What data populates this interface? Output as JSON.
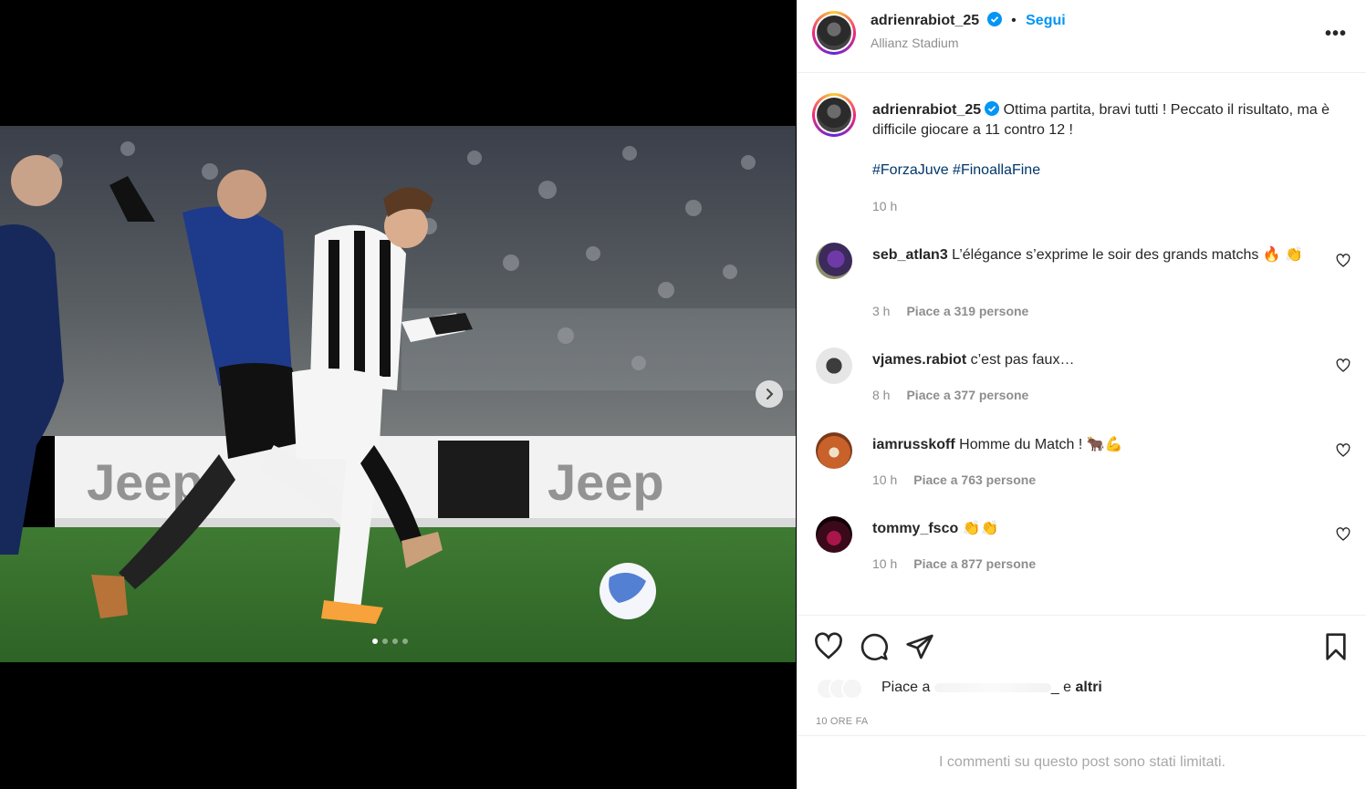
{
  "post": {
    "author": "adrienrabiot_25",
    "follow_label": "Segui",
    "separator": "•",
    "location": "Allianz Stadium",
    "more_label": "•••"
  },
  "caption": {
    "username": "adrienrabiot_25",
    "text": "Ottima partita, bravi tutti ! Peccato il risultato, ma è difficile giocare a 11 contro 12 !",
    "hashtag_1": "#ForzaJuve",
    "hashtag_2": "#FinoallaFine",
    "time": "10 h"
  },
  "comments": [
    {
      "username": "seb_atlan3",
      "text": "L’élégance s’exprime le soir des grands matchs 🔥 👏",
      "time": "3 h",
      "likes": "Piace a 319 persone"
    },
    {
      "username": "vjames.rabiot",
      "text": "c’est pas faux…",
      "time": "8 h",
      "likes": "Piace a 377 persone"
    },
    {
      "username": "iamrusskoff",
      "text": "Homme du Match ! 🐂💪",
      "time": "10 h",
      "likes": "Piace a 763 persone"
    },
    {
      "username": "tommy_fsco",
      "text": "👏👏",
      "time": "10 h",
      "likes": "Piace a 877 persone"
    }
  ],
  "likes_summary": {
    "prefix": "Piace a",
    "suffix": "_ e",
    "others": "altri"
  },
  "post_date": "10 ORE FA",
  "comments_limited": "I commenti su questo post sono stati limitati.",
  "carousel": {
    "total_slides": 4,
    "current_slide": 1
  },
  "colors": {
    "link": "#0095f6",
    "hashtag": "#00376b",
    "muted": "#8e8e8e",
    "verified": "#0095f6"
  },
  "icons": [
    "verified-icon",
    "more-icon",
    "heart-icon",
    "comment-icon",
    "share-icon",
    "save-icon",
    "next-arrow-icon"
  ]
}
